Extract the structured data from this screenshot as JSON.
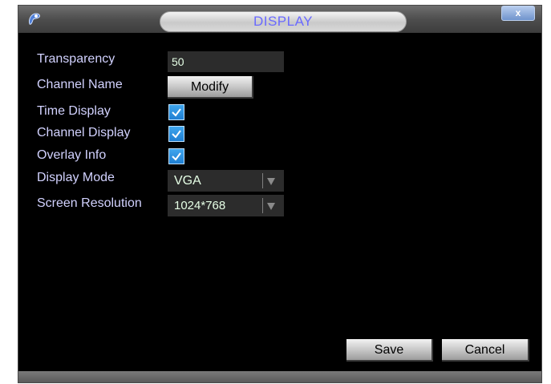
{
  "window": {
    "title": "DISPLAY",
    "close_label": "x"
  },
  "settings": {
    "transparency_label": "Transparency",
    "transparency_value": "50",
    "channel_name_label": "Channel Name",
    "modify_button": "Modify",
    "time_display_label": "Time Display",
    "time_display_checked": true,
    "channel_display_label": "Channel Display",
    "channel_display_checked": true,
    "overlay_info_label": "Overlay Info",
    "overlay_info_checked": true,
    "display_mode_label": "Display Mode",
    "display_mode_value": "VGA",
    "screen_resolution_label": "Screen Resolution",
    "screen_resolution_value": "1024*768"
  },
  "footer": {
    "save_label": "Save",
    "cancel_label": "Cancel"
  },
  "icons": {
    "app": "app-logo-icon",
    "close": "close-icon",
    "check": "check-icon",
    "dropdown": "dropdown-arrow-icon"
  },
  "colors": {
    "label_text": "#d2d2ff",
    "value_text": "#e6ffe6",
    "title_text": "#6a6aff",
    "checkbox_fill": "#2a8fe0",
    "background": "#000000"
  }
}
